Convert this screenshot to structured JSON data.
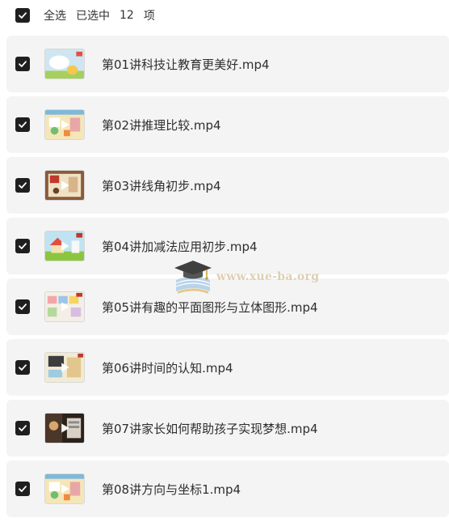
{
  "select_bar": {
    "label": "全选",
    "selected_prefix": "已选中",
    "selected_count": "12",
    "selected_suffix": "项"
  },
  "files": [
    {
      "title": "第01讲科技让教育更美好.mp4",
      "thumb": "white-blob"
    },
    {
      "title": "第02讲推理比较.mp4",
      "thumb": "pastel"
    },
    {
      "title": "第03讲线角初步.mp4",
      "thumb": "brown-board"
    },
    {
      "title": "第04讲加减法应用初步.mp4",
      "thumb": "green-house"
    },
    {
      "title": "第05讲有趣的平面图形与立体图形.mp4",
      "thumb": "cards"
    },
    {
      "title": "第06讲时间的认知.mp4",
      "thumb": "cream"
    },
    {
      "title": "第07讲家长如何帮助孩子实现梦想.mp4",
      "thumb": "dark"
    },
    {
      "title": "第08讲方向与坐标1.mp4",
      "thumb": "pastel"
    }
  ],
  "watermark": {
    "text": "www.xue-ba.org"
  },
  "colors": {
    "checkbox": "#1f1f1f",
    "row_bg": "#f4f4f4",
    "watermark": "#d9c7a6"
  }
}
